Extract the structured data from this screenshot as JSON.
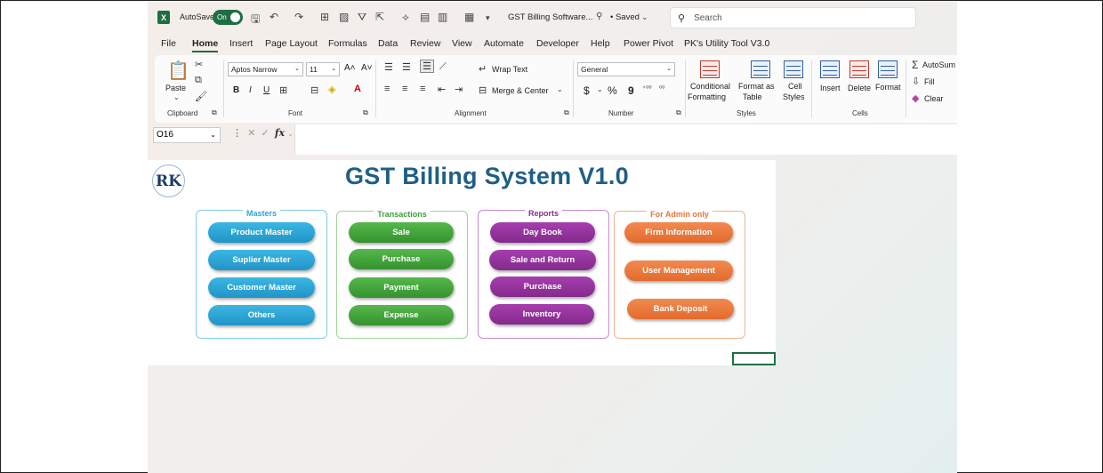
{
  "titlebar": {
    "app_icon": "X",
    "autosave_label": "AutoSave",
    "autosave_state": "On",
    "document_title": "GST Billing Software...",
    "saved_status": "• Saved",
    "search_placeholder": "Search"
  },
  "tabs": [
    "File",
    "Home",
    "Insert",
    "Page Layout",
    "Formulas",
    "Data",
    "Review",
    "View",
    "Automate",
    "Developer",
    "Help",
    "Power Pivot",
    "PK's Utility Tool V3.0"
  ],
  "active_tab": "Home",
  "ribbon": {
    "clipboard": {
      "paste": "Paste",
      "label": "Clipboard"
    },
    "font": {
      "name": "Aptos Narrow",
      "size": "11",
      "bold": "B",
      "italic": "I",
      "underline": "U",
      "label": "Font"
    },
    "alignment": {
      "wrap_text": "Wrap Text",
      "merge_center": "Merge & Center",
      "label": "Alignment"
    },
    "number": {
      "format": "General",
      "currency": "$",
      "percent": "%",
      "comma": "9",
      "label": "Number"
    },
    "styles": {
      "conditional_line1": "Conditional",
      "conditional_line2": "Formatting",
      "format_table_line1": "Format as",
      "format_table_line2": "Table",
      "cell_styles_line1": "Cell",
      "cell_styles_line2": "Styles",
      "label": "Styles"
    },
    "cells": {
      "insert": "Insert",
      "delete": "Delete",
      "format": "Format",
      "label": "Cells"
    },
    "editing": {
      "autosum": "AutoSum",
      "fill": "Fill",
      "clear": "Clear"
    }
  },
  "formula_bar": {
    "name_box": "O16",
    "fx": "fx",
    "value": ""
  },
  "sheet": {
    "logo_text": "RK",
    "title": "GST Billing System V1.0",
    "panels": [
      {
        "label": "Masters",
        "color": "#2aa7d6",
        "buttons": [
          "Product Master",
          "Suplier Master",
          "Customer Master",
          "Others"
        ]
      },
      {
        "label": "Transactions",
        "color": "#3f9e3a",
        "buttons": [
          "Sale",
          "Purchase",
          "Payment",
          "Expense"
        ]
      },
      {
        "label": "Reports",
        "color": "#8e2c97",
        "buttons": [
          "Day Book",
          "Sale and Return",
          "Purchase",
          "Inventory"
        ]
      },
      {
        "label": "For Admin only",
        "color": "#e6763a",
        "buttons": [
          "Firm Information",
          "User Management",
          "Bank Deposit"
        ]
      }
    ]
  },
  "colors": {
    "excel_green": "#1f6e43",
    "title_blue": "#1f5f86",
    "masters_border": "#7fcde9",
    "transactions_border": "#9fd39a",
    "reports_border": "#c78bd0",
    "admin_border": "#f0b38d"
  }
}
